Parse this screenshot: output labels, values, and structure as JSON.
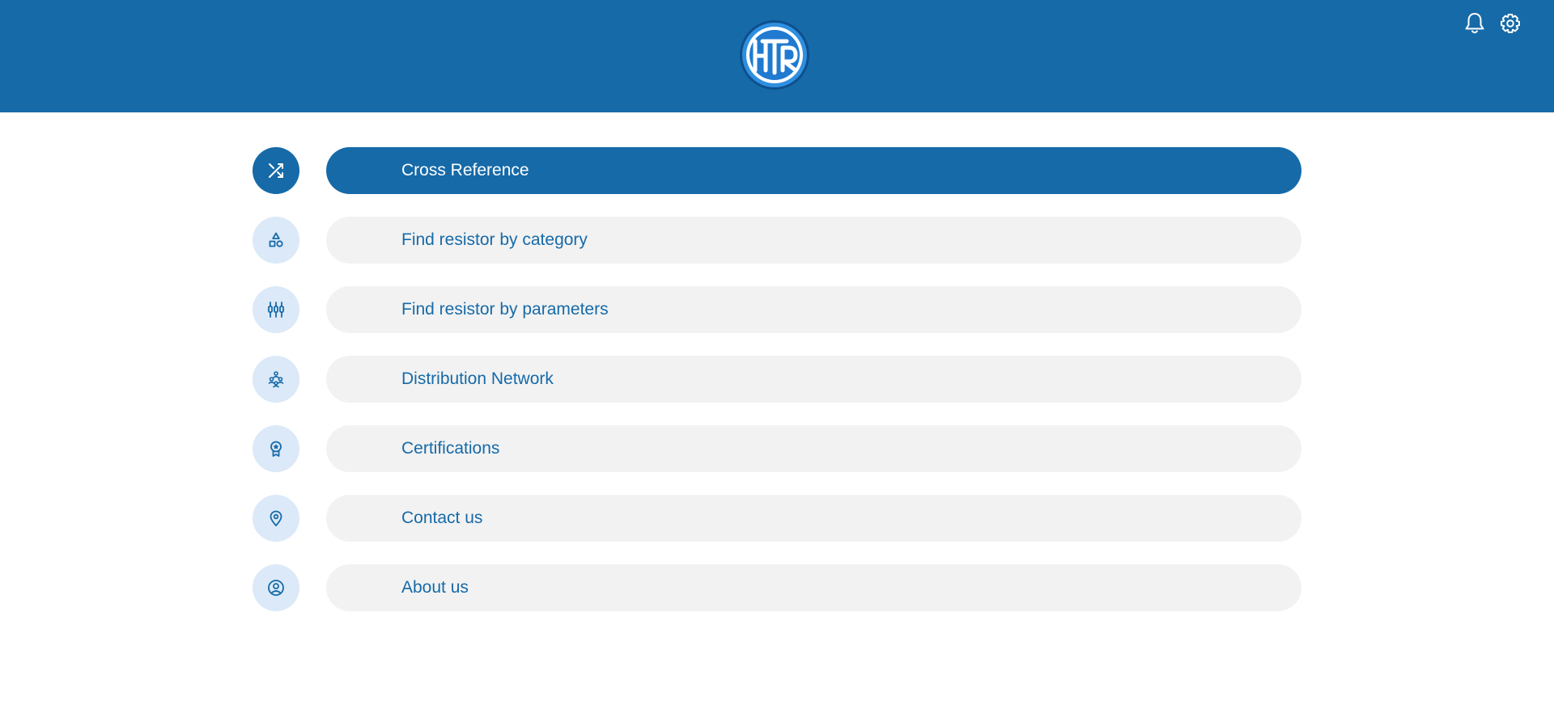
{
  "header": {
    "background": "#166aa8",
    "logo": {
      "text": "HTR",
      "icon": "htr-logo"
    },
    "actions": [
      {
        "name": "notifications",
        "icon": "bell-icon"
      },
      {
        "name": "settings",
        "icon": "gear-icon"
      }
    ]
  },
  "menu": {
    "accent": "#166aa8",
    "items": [
      {
        "label": "Cross Reference",
        "icon": "shuffle-icon",
        "active": true
      },
      {
        "label": "Find resistor by category",
        "icon": "shapes-icon",
        "active": false
      },
      {
        "label": "Find resistor by parameters",
        "icon": "resistor-parameters-icon",
        "active": false
      },
      {
        "label": "Distribution Network",
        "icon": "network-people-icon",
        "active": false
      },
      {
        "label": "Certifications",
        "icon": "award-icon",
        "active": false
      },
      {
        "label": "Contact us",
        "icon": "location-pin-icon",
        "active": false
      },
      {
        "label": "About us",
        "icon": "user-circle-icon",
        "active": false
      }
    ]
  }
}
